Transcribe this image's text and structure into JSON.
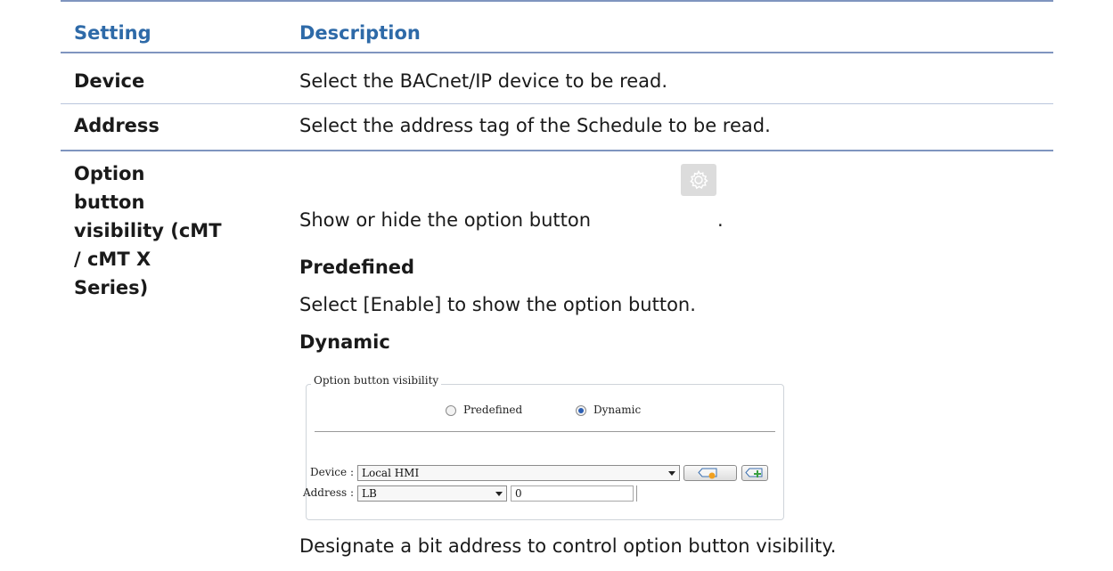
{
  "table": {
    "header": {
      "setting": "Setting",
      "description": "Description"
    },
    "rows": [
      {
        "setting": "Device",
        "description": "Select the BACnet/IP device to be read."
      },
      {
        "setting": "Address",
        "description": "Select the address tag of the Schedule to be read."
      },
      {
        "setting_lines": [
          "Option",
          "button",
          "visibility (cMT",
          "/ cMT X",
          "Series)"
        ],
        "intro": "Show or hide the option button",
        "intro_end": ".",
        "option_icon": "gear-icon",
        "predefined_title": "Predefined",
        "predefined_text": "Select [Enable] to show the option button.",
        "dynamic_title": "Dynamic",
        "dynamic_text": "Designate a bit address to control option button visibility."
      }
    ]
  },
  "dialog": {
    "group_title": "Option button visibility",
    "radio_predefined": "Predefined",
    "radio_dynamic": "Dynamic",
    "selected": "Dynamic",
    "device_label": "Device :",
    "device_value": "Local HMI",
    "address_label": "Address :",
    "address_type": "LB",
    "address_value": "0"
  },
  "colors": {
    "header": "#2e6aa8",
    "rule": "#7f95bf",
    "radio_selected": "#2c5fb4"
  }
}
